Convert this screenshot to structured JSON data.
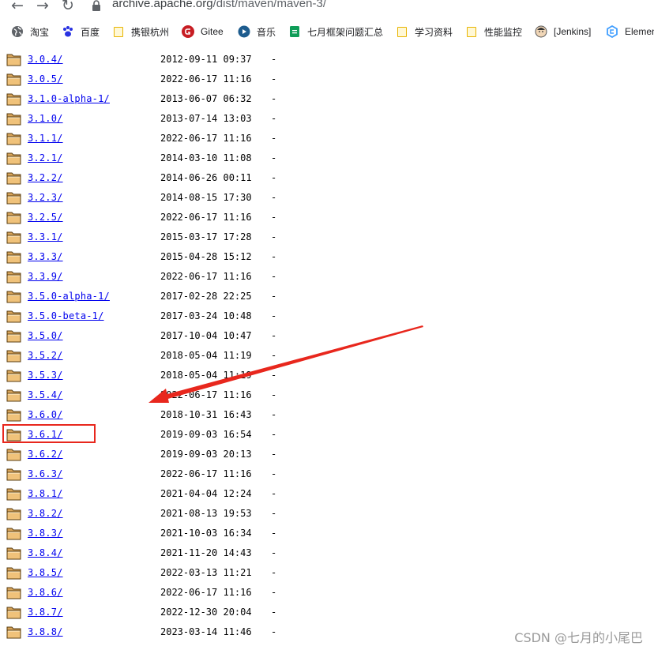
{
  "browser": {
    "url": {
      "host": "archive.apache.org",
      "path": "/dist/maven/maven-3/"
    },
    "bookmarks": [
      {
        "label": "淘宝",
        "icon": "globe-icon"
      },
      {
        "label": "百度",
        "icon": "baidu-paw-icon"
      },
      {
        "label": "携银杭州",
        "icon": "folder-icon"
      },
      {
        "label": "Gitee",
        "icon": "gitee-icon"
      },
      {
        "label": "音乐",
        "icon": "music-icon"
      },
      {
        "label": "七月框架问题汇总",
        "icon": "sheets-icon"
      },
      {
        "label": "学习资料",
        "icon": "folder-icon"
      },
      {
        "label": "性能监控",
        "icon": "folder-icon"
      },
      {
        "label": "[Jenkins]",
        "icon": "jenkins-icon"
      },
      {
        "label": "Elemen",
        "icon": "element-icon"
      }
    ]
  },
  "listing": [
    {
      "name": "3.0.4/",
      "date": "2012-09-11 09:37",
      "size": "-"
    },
    {
      "name": "3.0.5/",
      "date": "2022-06-17 11:16",
      "size": "-"
    },
    {
      "name": "3.1.0-alpha-1/",
      "date": "2013-06-07 06:32",
      "size": "-"
    },
    {
      "name": "3.1.0/",
      "date": "2013-07-14 13:03",
      "size": "-"
    },
    {
      "name": "3.1.1/",
      "date": "2022-06-17 11:16",
      "size": "-"
    },
    {
      "name": "3.2.1/",
      "date": "2014-03-10 11:08",
      "size": "-"
    },
    {
      "name": "3.2.2/",
      "date": "2014-06-26 00:11",
      "size": "-"
    },
    {
      "name": "3.2.3/",
      "date": "2014-08-15 17:30",
      "size": "-"
    },
    {
      "name": "3.2.5/",
      "date": "2022-06-17 11:16",
      "size": "-"
    },
    {
      "name": "3.3.1/",
      "date": "2015-03-17 17:28",
      "size": "-"
    },
    {
      "name": "3.3.3/",
      "date": "2015-04-28 15:12",
      "size": "-"
    },
    {
      "name": "3.3.9/",
      "date": "2022-06-17 11:16",
      "size": "-"
    },
    {
      "name": "3.5.0-alpha-1/",
      "date": "2017-02-28 22:25",
      "size": "-"
    },
    {
      "name": "3.5.0-beta-1/",
      "date": "2017-03-24 10:48",
      "size": "-"
    },
    {
      "name": "3.5.0/",
      "date": "2017-10-04 10:47",
      "size": "-"
    },
    {
      "name": "3.5.2/",
      "date": "2018-05-04 11:19",
      "size": "-"
    },
    {
      "name": "3.5.3/",
      "date": "2018-05-04 11:19",
      "size": "-"
    },
    {
      "name": "3.5.4/",
      "date": "2022-06-17 11:16",
      "size": "-"
    },
    {
      "name": "3.6.0/",
      "date": "2018-10-31 16:43",
      "size": "-"
    },
    {
      "name": "3.6.1/",
      "date": "2019-09-03 16:54",
      "size": "-"
    },
    {
      "name": "3.6.2/",
      "date": "2019-09-03 20:13",
      "size": "-"
    },
    {
      "name": "3.6.3/",
      "date": "2022-06-17 11:16",
      "size": "-"
    },
    {
      "name": "3.8.1/",
      "date": "2021-04-04 12:24",
      "size": "-"
    },
    {
      "name": "3.8.2/",
      "date": "2021-08-13 19:53",
      "size": "-"
    },
    {
      "name": "3.8.3/",
      "date": "2021-10-03 16:34",
      "size": "-"
    },
    {
      "name": "3.8.4/",
      "date": "2021-11-20 14:43",
      "size": "-"
    },
    {
      "name": "3.8.5/",
      "date": "2022-03-13 11:21",
      "size": "-"
    },
    {
      "name": "3.8.6/",
      "date": "2022-06-17 11:16",
      "size": "-"
    },
    {
      "name": "3.8.7/",
      "date": "2022-12-30 20:04",
      "size": "-"
    },
    {
      "name": "3.8.8/",
      "date": "2023-03-14 11:46",
      "size": "-"
    }
  ],
  "annotation": {
    "highlighted_item": "3.6.1/",
    "highlight_color": "#e8271d"
  },
  "watermark": "CSDN @七月的小尾巴"
}
